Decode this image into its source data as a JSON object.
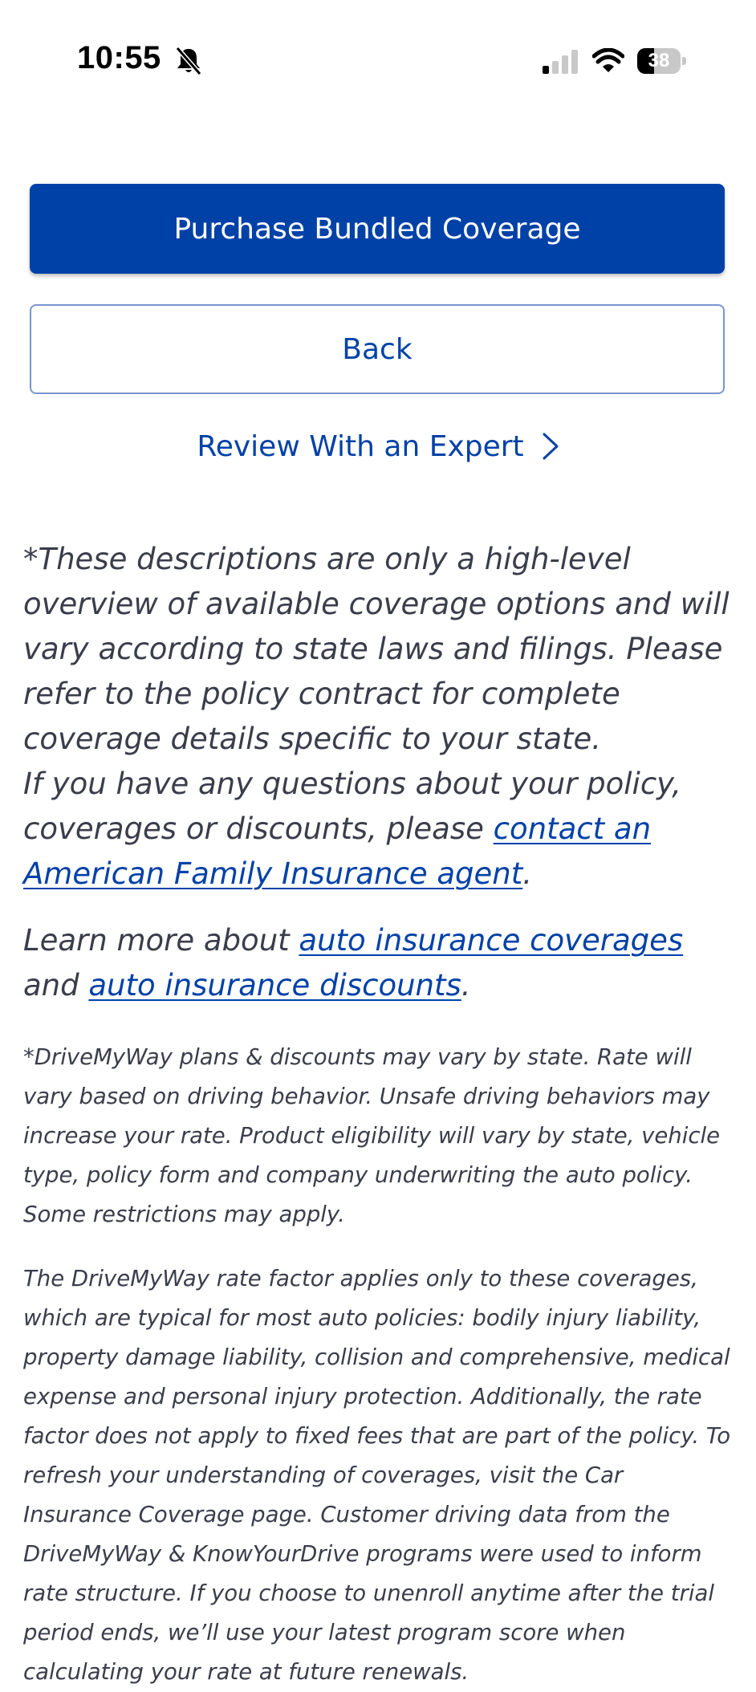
{
  "status_bar": {
    "time": "10:55",
    "battery_percent": 38,
    "battery_label": "38"
  },
  "actions": {
    "purchase_label": "Purchase Bundled Coverage",
    "back_label": "Back",
    "expert_label": "Review With an Expert"
  },
  "disclaimer": {
    "overview": "*These descriptions are only a high-level overview of available coverage options and will vary according to state laws and filings. Please refer to the policy contract for complete coverage details specific to your state.",
    "questions_prefix": "If you have any questions about your policy, coverages or discounts, please ",
    "agent_link": "contact an American Family Insurance agent",
    "questions_suffix": ".",
    "learn_prefix": "Learn more about ",
    "coverages_link": "auto insurance coverages",
    "learn_and": " and ",
    "discounts_link": "auto insurance discounts",
    "learn_suffix": "."
  },
  "fine_print": {
    "drivemyway": "*DriveMyWay plans & discounts may vary by state. Rate will vary based on driving behavior. Unsafe driving behaviors may increase your rate. Product eligibility will vary by state, vehicle type, policy form and company underwriting the auto policy. Some restrictions may apply.",
    "rate_factor": "The DriveMyWay rate factor applies only to these coverages, which are typical for most auto policies: bodily injury liability, property damage liability, collision and comprehensive, medical expense and personal injury protection. Additionally, the rate factor does not apply to fixed fees that are part of the policy. To refresh your understanding of coverages, visit the Car Insurance Coverage page. Customer driving data from the DriveMyWay & KnowYourDrive programs were used to inform rate structure. If you choose to unenroll anytime after the trial period ends, we’ll use your latest program score when calculating your rate at future renewals."
  },
  "colors": {
    "brand_blue": "#0041a8",
    "body_text": "#3a3d4a",
    "outline": "#7a95cf"
  },
  "icons": [
    "bell-off-icon",
    "signal-icon",
    "wifi-icon",
    "battery-icon",
    "chevron-right-icon"
  ]
}
